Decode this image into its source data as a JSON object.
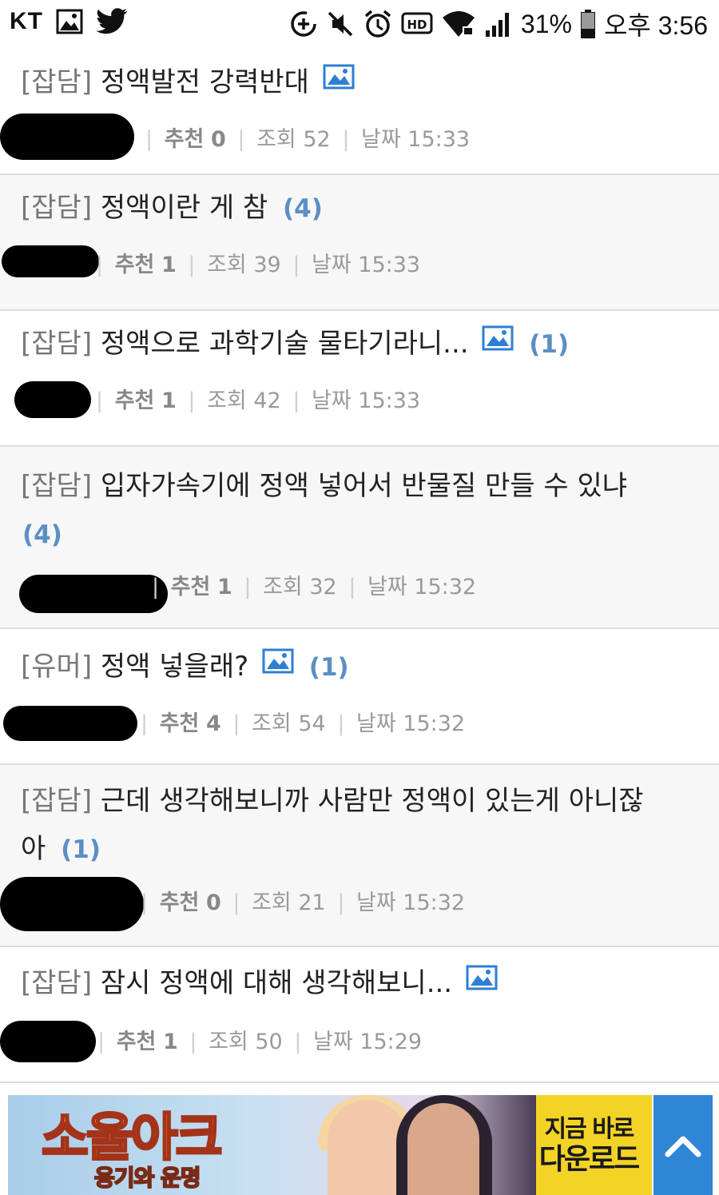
{
  "status_bar": {
    "carrier": "KT",
    "battery": "31%",
    "time": "오후 3:56",
    "icons": [
      "gallery-icon",
      "twitter-icon",
      "data-saver-icon",
      "mute-icon",
      "alarm-icon",
      "hd-icon",
      "wifi-icon",
      "signal-icon",
      "battery-icon"
    ]
  },
  "labels": {
    "recommend": "추천",
    "views": "조회",
    "date": "날짜",
    "separator": "|"
  },
  "posts": [
    {
      "category": "[잡담]",
      "title": "정액발전 강력반대",
      "has_image": true,
      "comments": "",
      "recommend": "0",
      "views": "52",
      "date": "15:33"
    },
    {
      "category": "[잡담]",
      "title": "정액이란 게 참",
      "has_image": false,
      "comments": "(4)",
      "recommend": "1",
      "views": "39",
      "date": "15:33"
    },
    {
      "category": "[잡담]",
      "title": "정액으로 과학기술 물타기라니...",
      "has_image": true,
      "comments": "(1)",
      "recommend": "1",
      "views": "42",
      "date": "15:33"
    },
    {
      "category": "[잡담]",
      "title": "입자가속기에 정액 넣어서 반물질 만들 수 있냐",
      "has_image": false,
      "comments": "(4)",
      "recommend": "1",
      "views": "32",
      "date": "15:32"
    },
    {
      "category": "[유머]",
      "title": "정액 넣을래?",
      "has_image": true,
      "comments": "(1)",
      "recommend": "4",
      "views": "54",
      "date": "15:32"
    },
    {
      "category": "[잡담]",
      "title": "근데 생각해보니까 사람만 정액이 있는게 아니잖",
      "title_cont": "아",
      "has_image": false,
      "comments": "(1)",
      "recommend": "0",
      "views": "21",
      "date": "15:32"
    },
    {
      "category": "[잡담]",
      "title": "잠시 정액에 대해 생각해보니...",
      "has_image": true,
      "comments": "",
      "recommend": "1",
      "views": "50",
      "date": "15:29"
    }
  ],
  "ad": {
    "title": "소울아크",
    "subtitle": "용기와 운명",
    "cta_line1": "지금 바로",
    "cta_line2": "다운로드"
  },
  "scroll_top": {
    "icon": "chevron-up-icon"
  }
}
